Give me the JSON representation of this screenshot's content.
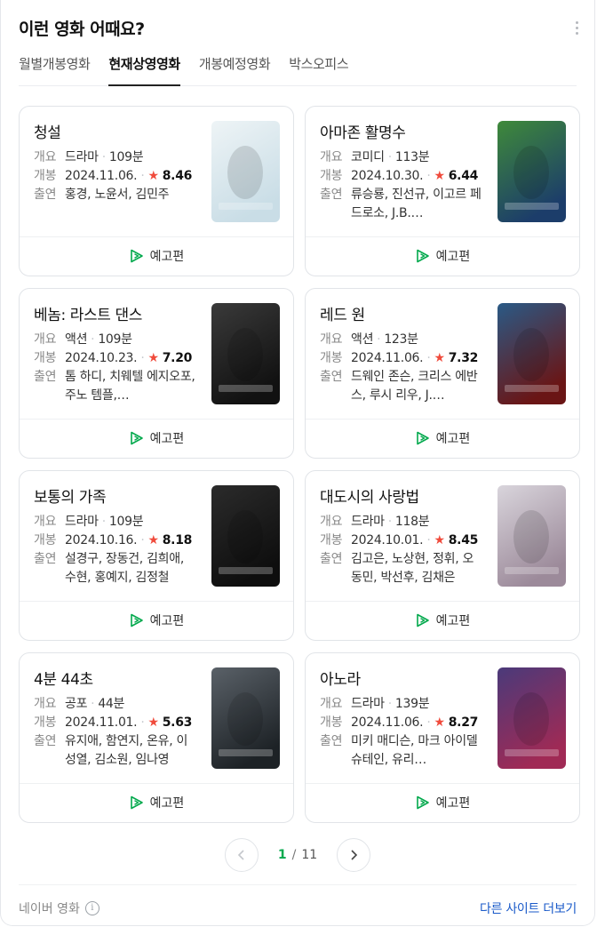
{
  "header": {
    "title": "이런 영화 어때요?",
    "more_icon": "vertical-ellipsis-icon"
  },
  "tabs": [
    {
      "label": "월별개봉영화",
      "active": false
    },
    {
      "label": "현재상영영화",
      "active": true
    },
    {
      "label": "개봉예정영화",
      "active": false
    },
    {
      "label": "박스오피스",
      "active": false
    }
  ],
  "labels": {
    "summary": "개요",
    "release": "개봉",
    "cast": "출연",
    "trailer": "예고편"
  },
  "movies": [
    {
      "title": "청설",
      "genre": "드라마",
      "runtime": "109분",
      "date": "2024.11.06.",
      "rating": "8.46",
      "cast": "홍경, 노윤서, 김민주",
      "poster_colors": [
        "#eef4f6",
        "#c9dde6"
      ]
    },
    {
      "title": "아마존 활명수",
      "genre": "코미디",
      "runtime": "113분",
      "date": "2024.10.30.",
      "rating": "6.44",
      "cast": "류승룡, 진선규, 이고르 페드로소, J.B.…",
      "poster_colors": [
        "#3f8a3a",
        "#1c3d6a"
      ]
    },
    {
      "title": "베놈: 라스트 댄스",
      "genre": "액션",
      "runtime": "109분",
      "date": "2024.10.23.",
      "rating": "7.20",
      "cast": "톰 하디, 치웨텔 에지오포, 주노 템플,…",
      "poster_colors": [
        "#3a3a3a",
        "#111111"
      ]
    },
    {
      "title": "레드 원",
      "genre": "액션",
      "runtime": "123분",
      "date": "2024.11.06.",
      "rating": "7.32",
      "cast": "드웨인 존슨, 크리스 에반스, 루시 리우, J.…",
      "poster_colors": [
        "#2a5a86",
        "#6a1515"
      ]
    },
    {
      "title": "보통의 가족",
      "genre": "드라마",
      "runtime": "109분",
      "date": "2024.10.16.",
      "rating": "8.18",
      "cast": "설경구, 장동건, 김희애, 수현, 홍예지, 김정철",
      "poster_colors": [
        "#2b2b2b",
        "#0e0e0e"
      ]
    },
    {
      "title": "대도시의 사랑법",
      "genre": "드라마",
      "runtime": "118분",
      "date": "2024.10.01.",
      "rating": "8.45",
      "cast": "김고은, 노상현, 정휘, 오동민, 박선후, 김채은",
      "poster_colors": [
        "#d9d5dc",
        "#9c8a9a"
      ]
    },
    {
      "title": "4분 44초",
      "genre": "공포",
      "runtime": "44분",
      "date": "2024.11.01.",
      "rating": "5.63",
      "cast": "유지애, 함연지, 온유, 이성열, 김소원, 임나영",
      "poster_colors": [
        "#5a6168",
        "#1d2226"
      ]
    },
    {
      "title": "아노라",
      "genre": "드라마",
      "runtime": "139분",
      "date": "2024.11.06.",
      "rating": "8.27",
      "cast": "미키 매디슨, 마크 아이델슈테인, 유리…",
      "poster_colors": [
        "#4a3a7a",
        "#a02a55"
      ]
    }
  ],
  "pagination": {
    "current": "1",
    "separator": "/",
    "total": "11"
  },
  "footer": {
    "source": "네이버 영화",
    "more_sites": "다른 사이트 더보기"
  },
  "colors": {
    "accent_green": "#03a94d",
    "star_red": "#f04b3c",
    "link_blue": "#1a5ac9"
  }
}
